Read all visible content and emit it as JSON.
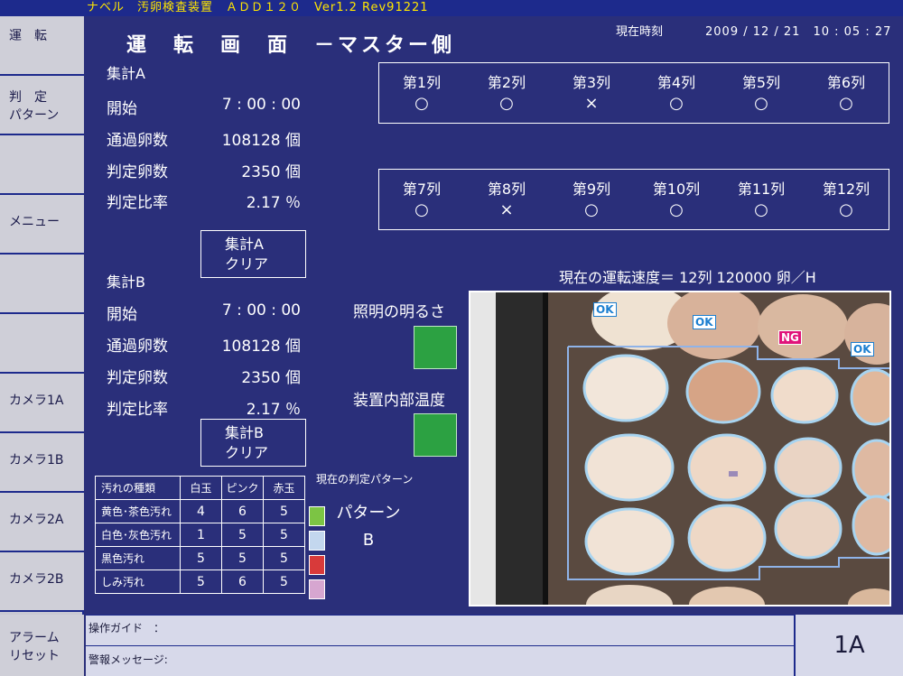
{
  "title_bar": "ナベル　汚卵検査装置　ＡＤＤ１２０　Ver1.2 Rev91221",
  "sidebar": [
    {
      "label": "運　転"
    },
    {
      "label": "判　定\nパターン"
    },
    {
      "label": ""
    },
    {
      "label": "メニュー"
    },
    {
      "label": ""
    },
    {
      "label": ""
    },
    {
      "label": "カメラ1A"
    },
    {
      "label": "カメラ1B"
    },
    {
      "label": "カメラ2A"
    },
    {
      "label": "カメラ2B"
    },
    {
      "label": "アラーム\nリセット"
    }
  ],
  "header": {
    "title": "運　転　画　面　－マスター側",
    "clock_label": "現在時刻",
    "clock_value": "2009 / 12 / 21　10 : 05 : 27"
  },
  "summary_a": {
    "heading": "集計A",
    "rows": [
      {
        "label": "開始",
        "value": "7 : 00 : 00"
      },
      {
        "label": "通過卵数",
        "value": "108128 個"
      },
      {
        "label": "判定卵数",
        "value": "2350 個"
      },
      {
        "label": "判定比率",
        "value": "2.17 ％"
      }
    ],
    "clear_label": "集計A\nクリア"
  },
  "summary_b": {
    "heading": "集計B",
    "rows": [
      {
        "label": "開始",
        "value": "7 : 00 : 00"
      },
      {
        "label": "通過卵数",
        "value": "108128 個"
      },
      {
        "label": "判定卵数",
        "value": "2350 個"
      },
      {
        "label": "判定比率",
        "value": "2.17 ％"
      }
    ],
    "clear_label": "集計B\nクリア"
  },
  "lanes_top": [
    {
      "name": "第1列",
      "mark": "○"
    },
    {
      "name": "第2列",
      "mark": "○"
    },
    {
      "name": "第3列",
      "mark": "×"
    },
    {
      "name": "第4列",
      "mark": "○"
    },
    {
      "name": "第5列",
      "mark": "○"
    },
    {
      "name": "第6列",
      "mark": "○"
    }
  ],
  "lanes_bottom": [
    {
      "name": "第7列",
      "mark": "○"
    },
    {
      "name": "第8列",
      "mark": "×"
    },
    {
      "name": "第9列",
      "mark": "○"
    },
    {
      "name": "第10列",
      "mark": "○"
    },
    {
      "name": "第11列",
      "mark": "○"
    },
    {
      "name": "第12列",
      "mark": "○"
    }
  ],
  "speed_text": "現在の運転速度＝ 12列 120000 卵／H",
  "indicators": [
    {
      "label": "照明の明るさ",
      "color": "#2ca142"
    },
    {
      "label": "装置内部温度",
      "color": "#2ca142"
    }
  ],
  "camera_badges": [
    "OK",
    "OK",
    "NG",
    "OK"
  ],
  "dirt_table": {
    "headers": [
      "汚れの種類",
      "白玉",
      "ピンク",
      "赤玉"
    ],
    "rows": [
      {
        "name": "黄色･茶色汚れ",
        "values": [
          "4",
          "6",
          "5"
        ],
        "color": "#7cc444"
      },
      {
        "name": "白色･灰色汚れ",
        "values": [
          "1",
          "5",
          "5"
        ],
        "color": "#c3d7ee"
      },
      {
        "name": "黒色汚れ",
        "values": [
          "5",
          "5",
          "5"
        ],
        "color": "#d83a3a"
      },
      {
        "name": "しみ汚れ",
        "values": [
          "5",
          "6",
          "5"
        ],
        "color": "#d6a6d0"
      }
    ]
  },
  "current_pattern_label": "現在の判定パターン",
  "current_pattern": "パターン\nB",
  "footer": {
    "guide_label": "操作ガイド　：",
    "message_label": "警報メッセージ:",
    "camera_id": "1A"
  },
  "colors": {
    "background": "#2a2f7a",
    "title_bar": "#1d2a8c",
    "title_text": "#ffe600",
    "sidebar": "#cfcfd8",
    "footer": "#d7d9ea"
  }
}
